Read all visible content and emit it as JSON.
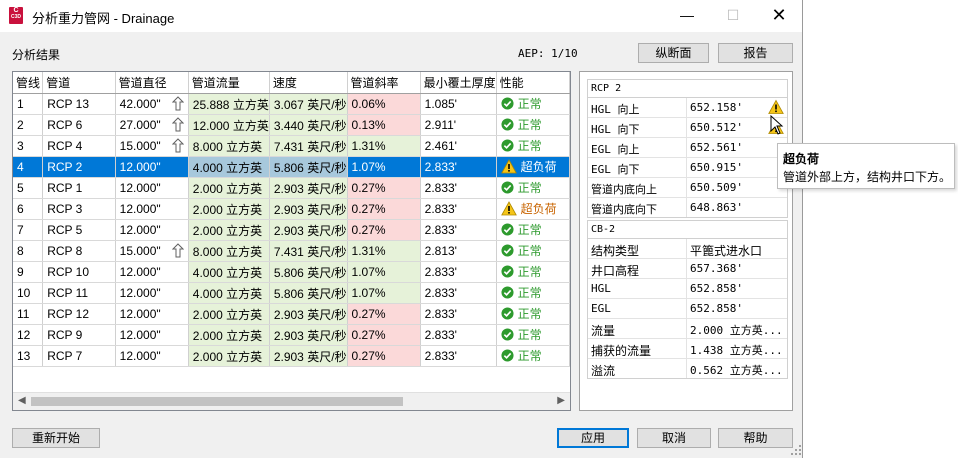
{
  "window": {
    "icon_text_1": "C",
    "icon_text_2": "C3D",
    "title": "分析重力管网 - Drainage",
    "minimize_glyph": "—",
    "maximize_glyph": "☐",
    "close_glyph": "✕"
  },
  "header": {
    "results_label": "分析结果",
    "aep_label": "AEP: 1/10",
    "profile_button": "纵断面",
    "report_button": "报告"
  },
  "grid": {
    "columns": [
      "管线",
      "管道",
      "管道直径",
      "管道流量",
      "速度",
      "管道斜率",
      "最小覆土厚度",
      "性能"
    ],
    "rows": [
      {
        "line": "1",
        "pipe": "RCP 13",
        "dia": "42.000\"",
        "arrow": true,
        "flow": "25.888 立方英",
        "vel": "3.067 英尺/秒",
        "slope": "0.06%",
        "slope_state": "red",
        "cover": "1.085'",
        "perf": "正常",
        "perf_state": "ok"
      },
      {
        "line": "2",
        "pipe": "RCP 6",
        "dia": "27.000\"",
        "arrow": true,
        "flow": "12.000 立方英",
        "vel": "3.440 英尺/秒",
        "slope": "0.13%",
        "slope_state": "red",
        "cover": "2.911'",
        "perf": "正常",
        "perf_state": "ok"
      },
      {
        "line": "3",
        "pipe": "RCP 4",
        "dia": "15.000\"",
        "arrow": true,
        "flow": "8.000 立方英",
        "vel": "7.431 英尺/秒",
        "slope": "1.31%",
        "slope_state": "green",
        "cover": "2.461'",
        "perf": "正常",
        "perf_state": "ok"
      },
      {
        "line": "4",
        "pipe": "RCP 2",
        "dia": "12.000\"",
        "arrow": false,
        "flow": "4.000 立方英",
        "vel": "5.806 英尺/秒",
        "slope": "1.07%",
        "slope_state": "green",
        "cover": "2.833'",
        "perf": "超负荷",
        "perf_state": "warn",
        "selected": true
      },
      {
        "line": "5",
        "pipe": "RCP 1",
        "dia": "12.000\"",
        "arrow": false,
        "flow": "2.000 立方英",
        "vel": "2.903 英尺/秒",
        "slope": "0.27%",
        "slope_state": "red",
        "cover": "2.833'",
        "perf": "正常",
        "perf_state": "ok"
      },
      {
        "line": "6",
        "pipe": "RCP 3",
        "dia": "12.000\"",
        "arrow": false,
        "flow": "2.000 立方英",
        "vel": "2.903 英尺/秒",
        "slope": "0.27%",
        "slope_state": "red",
        "cover": "2.833'",
        "perf": "超负荷",
        "perf_state": "warn"
      },
      {
        "line": "7",
        "pipe": "RCP 5",
        "dia": "12.000\"",
        "arrow": false,
        "flow": "2.000 立方英",
        "vel": "2.903 英尺/秒",
        "slope": "0.27%",
        "slope_state": "red",
        "cover": "2.833'",
        "perf": "正常",
        "perf_state": "ok"
      },
      {
        "line": "8",
        "pipe": "RCP 8",
        "dia": "15.000\"",
        "arrow": true,
        "flow": "8.000 立方英",
        "vel": "7.431 英尺/秒",
        "slope": "1.31%",
        "slope_state": "green",
        "cover": "2.813'",
        "perf": "正常",
        "perf_state": "ok"
      },
      {
        "line": "9",
        "pipe": "RCP 10",
        "dia": "12.000\"",
        "arrow": false,
        "flow": "4.000 立方英",
        "vel": "5.806 英尺/秒",
        "slope": "1.07%",
        "slope_state": "green",
        "cover": "2.833'",
        "perf": "正常",
        "perf_state": "ok"
      },
      {
        "line": "10",
        "pipe": "RCP 11",
        "dia": "12.000\"",
        "arrow": false,
        "flow": "4.000 立方英",
        "vel": "5.806 英尺/秒",
        "slope": "1.07%",
        "slope_state": "green",
        "cover": "2.833'",
        "perf": "正常",
        "perf_state": "ok"
      },
      {
        "line": "11",
        "pipe": "RCP 12",
        "dia": "12.000\"",
        "arrow": false,
        "flow": "2.000 立方英",
        "vel": "2.903 英尺/秒",
        "slope": "0.27%",
        "slope_state": "red",
        "cover": "2.833'",
        "perf": "正常",
        "perf_state": "ok"
      },
      {
        "line": "12",
        "pipe": "RCP 9",
        "dia": "12.000\"",
        "arrow": false,
        "flow": "2.000 立方英",
        "vel": "2.903 英尺/秒",
        "slope": "0.27%",
        "slope_state": "red",
        "cover": "2.833'",
        "perf": "正常",
        "perf_state": "ok"
      },
      {
        "line": "13",
        "pipe": "RCP 7",
        "dia": "12.000\"",
        "arrow": false,
        "flow": "2.000 立方英",
        "vel": "2.903 英尺/秒",
        "slope": "0.27%",
        "slope_state": "red",
        "cover": "2.833'",
        "perf": "正常",
        "perf_state": "ok"
      }
    ],
    "scroll_left": "◀",
    "scroll_right": "▶"
  },
  "pipe_panel": {
    "title": "RCP 2",
    "rows": [
      {
        "key": "HGL 向上",
        "value": "652.158'",
        "warn": true
      },
      {
        "key": "HGL 向下",
        "value": "650.512'",
        "warn": true
      },
      {
        "key": "EGL 向上",
        "value": "652.561'",
        "warn": false
      },
      {
        "key": "EGL 向下",
        "value": "650.915'",
        "warn": false
      },
      {
        "key": "管道内底向上",
        "value": "650.509'",
        "warn": false
      },
      {
        "key": "管道内底向下",
        "value": "648.863'",
        "warn": false
      }
    ]
  },
  "structure_panel": {
    "title": "CB-2",
    "rows": [
      {
        "key": "结构类型",
        "value": "平篦式进水口"
      },
      {
        "key": "井口高程",
        "value": "657.368'"
      },
      {
        "key": "HGL",
        "value": "652.858'"
      },
      {
        "key": "EGL",
        "value": "652.858'"
      },
      {
        "key": "流量",
        "value": "2.000 立方英..."
      },
      {
        "key": "捕获的流量",
        "value": "1.438 立方英..."
      },
      {
        "key": "溢流",
        "value": "0.562 立方英..."
      }
    ]
  },
  "tooltip": {
    "title": "超负荷",
    "body": "管道外部上方，结构井口下方。"
  },
  "footer": {
    "restart_button": "重新开始",
    "apply_button": "应用",
    "cancel_button": "取消",
    "help_button": "帮助"
  },
  "colors": {
    "selected": "#0078d7",
    "ok_green": "#2d9a2d",
    "warn_orange": "#c86400",
    "cell_green": "#e6f2d9",
    "cell_red": "#fbd9d9"
  },
  "icons": [
    "app-icon",
    "minimize-icon",
    "maximize-icon",
    "close-icon",
    "up-arrow-icon",
    "check-circle-icon",
    "warning-icon",
    "cursor-icon",
    "resize-grip-icon"
  ]
}
